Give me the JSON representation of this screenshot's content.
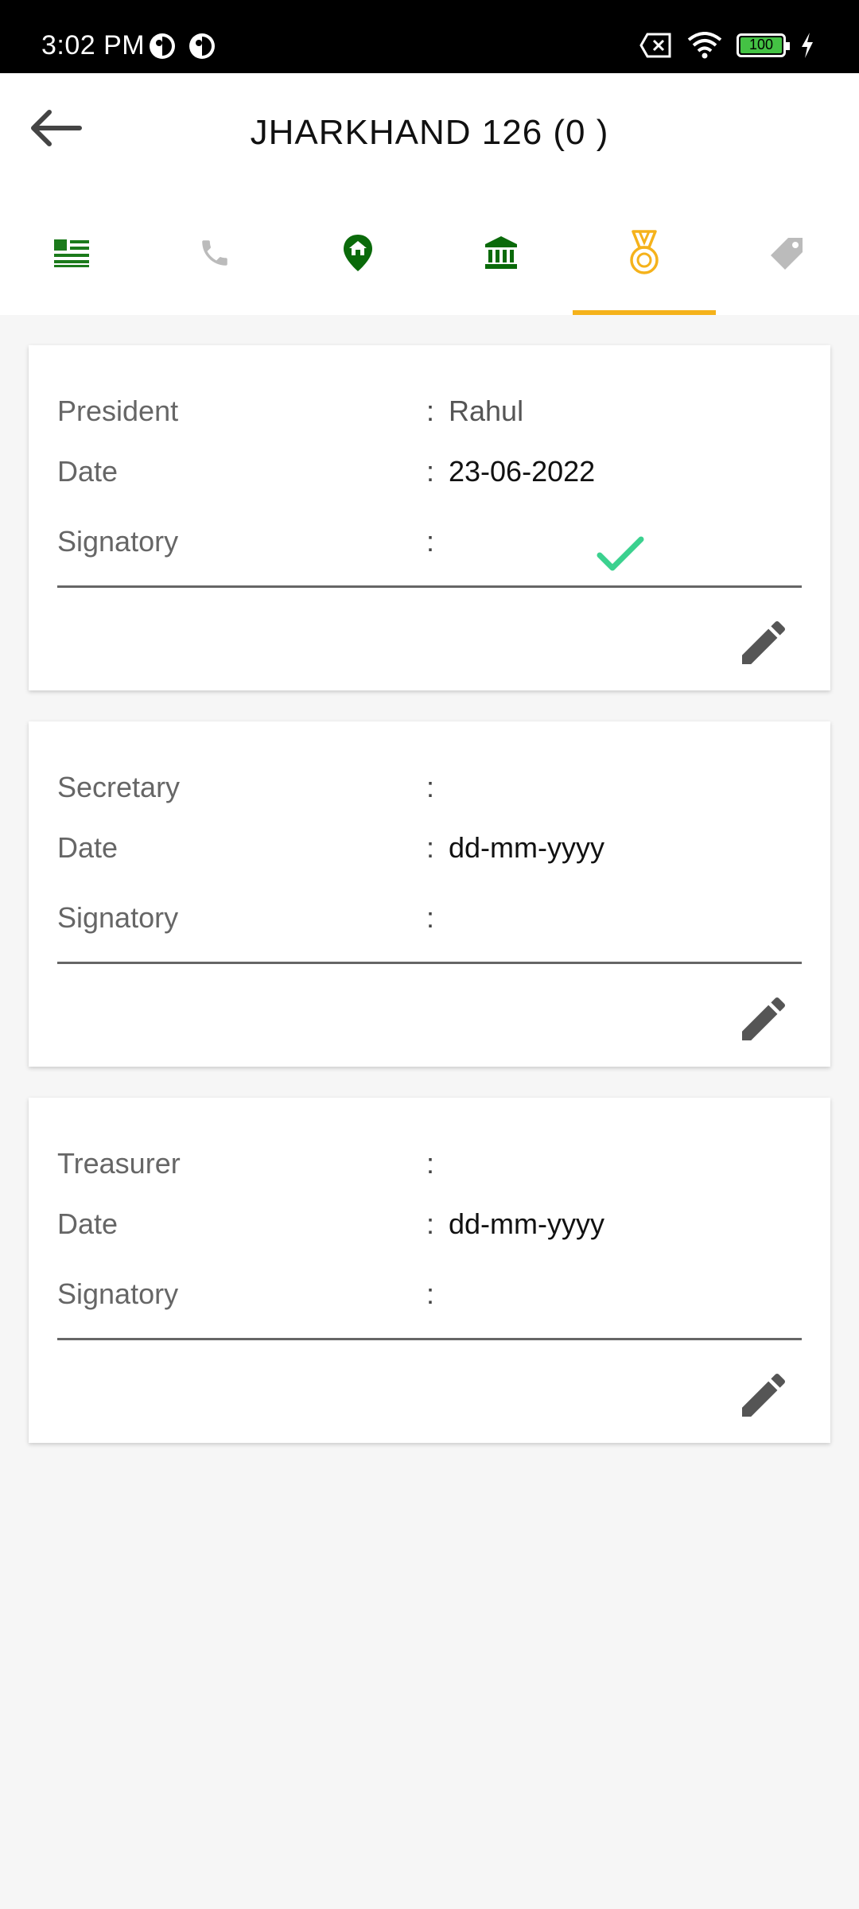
{
  "status_bar": {
    "time": "3:02 PM",
    "battery": "100"
  },
  "header": {
    "title": "JHARKHAND 126 (0 )"
  },
  "tabs": [
    {
      "icon": "list-icon",
      "color": "#1b7a1b"
    },
    {
      "icon": "phone-icon",
      "color": "#bbbbbb"
    },
    {
      "icon": "home-pin-icon",
      "color": "#0a6a0a"
    },
    {
      "icon": "bank-icon",
      "color": "#0a6a0a"
    },
    {
      "icon": "medal-icon",
      "color": "#f5b21b",
      "active": true
    },
    {
      "icon": "tag-icon",
      "color": "#bbbbbb"
    }
  ],
  "colors": {
    "accent": "#f5b21b",
    "check": "#3bd18f"
  },
  "cards": [
    {
      "role_label": "President",
      "role_value": "Rahul",
      "date_label": "Date",
      "date_value": "23-06-2022",
      "signatory_label": "Signatory",
      "signed": true
    },
    {
      "role_label": "Secretary",
      "role_value": "",
      "date_label": "Date",
      "date_value": "dd-mm-yyyy",
      "signatory_label": "Signatory",
      "signed": false
    },
    {
      "role_label": "Treasurer",
      "role_value": "",
      "date_label": "Date",
      "date_value": "dd-mm-yyyy",
      "signatory_label": "Signatory",
      "signed": false
    }
  ],
  "colon": ":"
}
